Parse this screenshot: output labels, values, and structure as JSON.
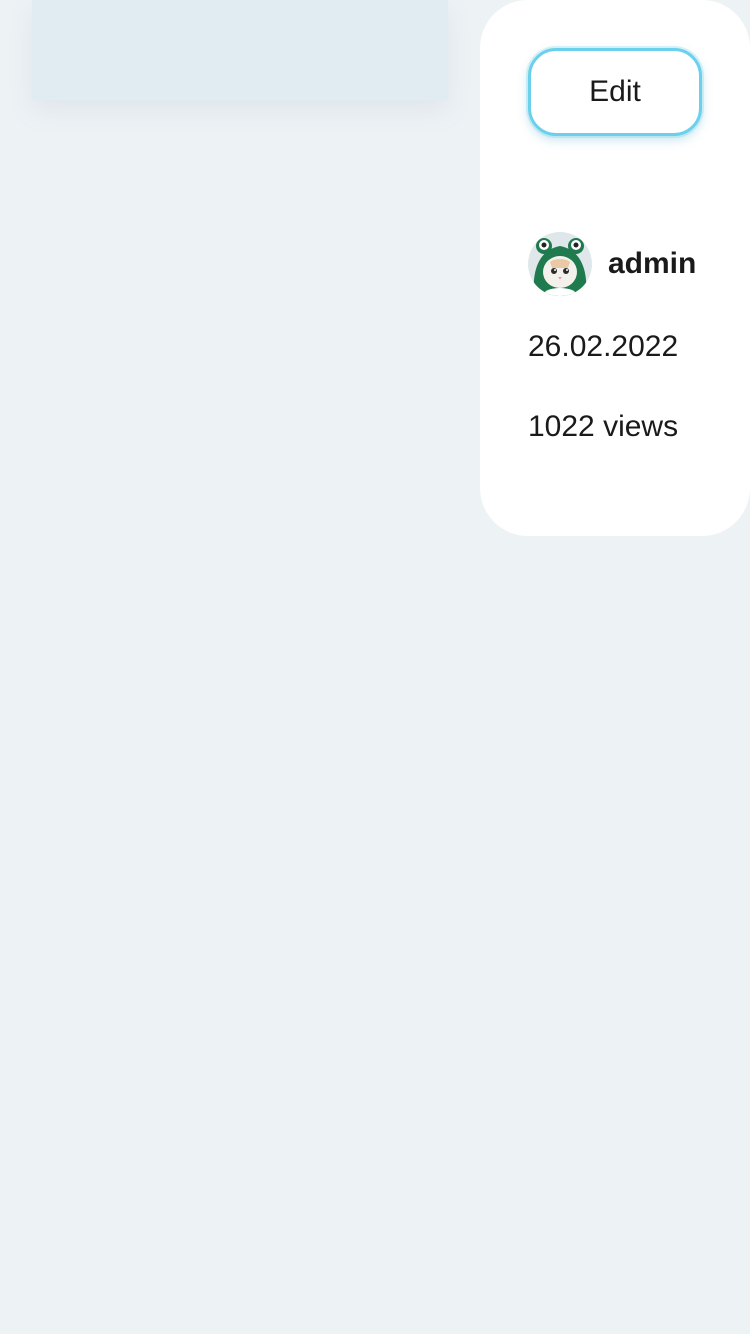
{
  "panel": {
    "edit_label": "Edit",
    "author": {
      "name": "admin",
      "avatar_icon": "cat-in-frog-hood-avatar"
    },
    "date": "26.02.2022",
    "views": "1022 views"
  },
  "colors": {
    "page_background": "#edf2f5",
    "content_card": "#e1ecf2",
    "panel_background": "#ffffff",
    "edit_border": "#6ad0ec",
    "text": "#1a1a1a"
  }
}
